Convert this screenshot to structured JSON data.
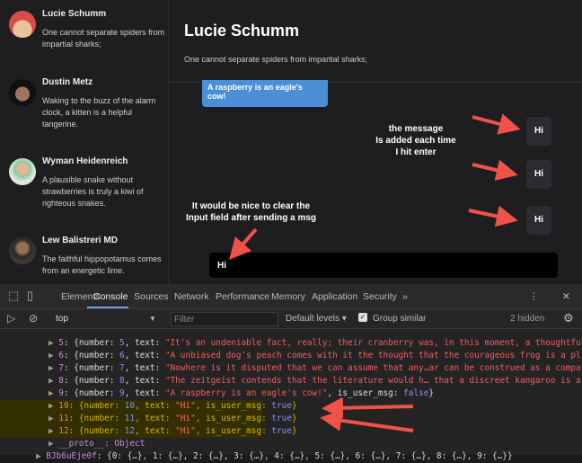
{
  "contacts": [
    {
      "name": "Lucie Schumm",
      "message": "One cannot separate spiders from impartial sharks;",
      "color": "#d84b4b"
    },
    {
      "name": "Dustin Metz",
      "message": "Waking to the buzz of the alarm clock, a kitten is a helpful tangerine.",
      "color": "#111111"
    },
    {
      "name": "Wyman Heidenreich",
      "message": "A plausible snake without strawberries is truly a kiwi of righteous snakes.",
      "color": "#cfe3c8"
    },
    {
      "name": "Lew Balistreri MD",
      "message": "The faithful hippopotamus comes from an energetic lime.",
      "color": "#5a4a3a"
    }
  ],
  "chat": {
    "title": "Lucie Schumm",
    "subtitle": "One cannot separate spiders from impartial sharks;",
    "bot_message": "A raspberry is an eagle's cow!",
    "user_messages": [
      "Hi",
      "Hi",
      "Hi"
    ],
    "input_value": "Hi"
  },
  "annotations": {
    "note1": "the message\nIs added each time\nI hit enter",
    "note2": "It would be nice to clear the\nInput field after sending a msg"
  },
  "devtools": {
    "tabs": [
      "Elements",
      "Console",
      "Sources",
      "Network",
      "Performance",
      "Memory",
      "Application",
      "Security",
      "»"
    ],
    "context": "top",
    "filter_placeholder": "Filter",
    "levels": "Default levels ▾",
    "group_similar": "Group similar",
    "hidden": "2 hidden",
    "lines": [
      {
        "idx": "5",
        "num": "5",
        "text": "\"It's an undeniable fact, really; their cranberry was, in this moment, a thoughtful"
      },
      {
        "idx": "6",
        "num": "6",
        "text": "\"A unbiased dog's peach comes with it the thought that the courageous frog is a pl"
      },
      {
        "idx": "7",
        "num": "7",
        "text": "\"Nowhere is it disputed that we can assume that any…ar can be construed as a compa"
      },
      {
        "idx": "8",
        "num": "8",
        "text": "\"The zeitgeist contends that the literature would h… that a discreet kangaroo is a"
      },
      {
        "idx": "9",
        "num": "9",
        "text": "\"A raspberry is an eagle's cow!\"",
        "flag": "false"
      },
      {
        "idx": "10",
        "num": "10",
        "text": "\"Hi\"",
        "flag": "true"
      },
      {
        "idx": "11",
        "num": "11",
        "text": "\"Hi\"",
        "flag": "true"
      },
      {
        "idx": "12",
        "num": "12",
        "text": "\"Hi\"",
        "flag": "true"
      }
    ],
    "proto": "__proto__: Object",
    "last_key": "BJb6uEje0f",
    "last_value": "{0: {…}, 1: {…}, 2: {…}, 3: {…}, 4: {…}, 5: {…}, 6: {…}, 7: {…}, 8: {…}, 9: {…}}"
  }
}
